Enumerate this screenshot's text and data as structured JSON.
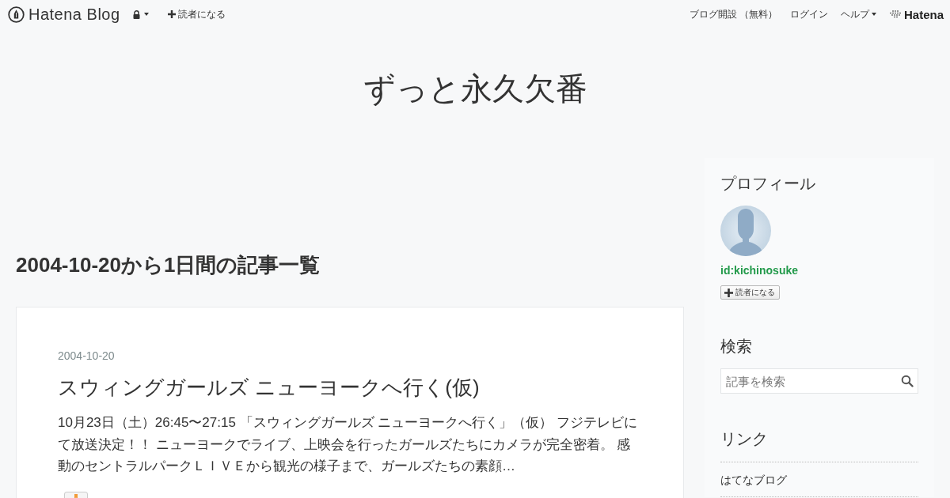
{
  "top_bar": {
    "logo": "Hatena Blog",
    "subscribe": "読者になる",
    "links": [
      {
        "label": "ブログ開設 （無料）",
        "kind": "link"
      },
      {
        "label": "ログイン",
        "kind": "link"
      },
      {
        "label": "ヘルプ",
        "kind": "menu"
      }
    ],
    "brand": "Hatena"
  },
  "blog_title": "ずっと永久欠番",
  "archive_heading": "2004-10-20から1日間の記事一覧",
  "entries": [
    {
      "date": "2004-10-20",
      "title": "スウィングガールズ ニューヨークへ行く(仮)",
      "summary": "10月23日（土）26:45〜27:15 「スウィングガールズ ニューヨークへ行く」（仮） フジテレビにて放送決定！！ ニューヨークでライブ、上映会を行ったガールズたちにカメラが完全密着。 感動のセントラルパークＬＩＶＥから観光の様子まで、ガールズたちの素顔…"
    }
  ],
  "sidebar": {
    "profile": {
      "heading": "プロフィール",
      "user_id": "id:kichinosuke",
      "subscribe": "読者になる"
    },
    "search": {
      "heading": "検索",
      "placeholder": "記事を検索"
    },
    "links": {
      "heading": "リンク",
      "items": [
        "はてなブログ"
      ]
    }
  }
}
